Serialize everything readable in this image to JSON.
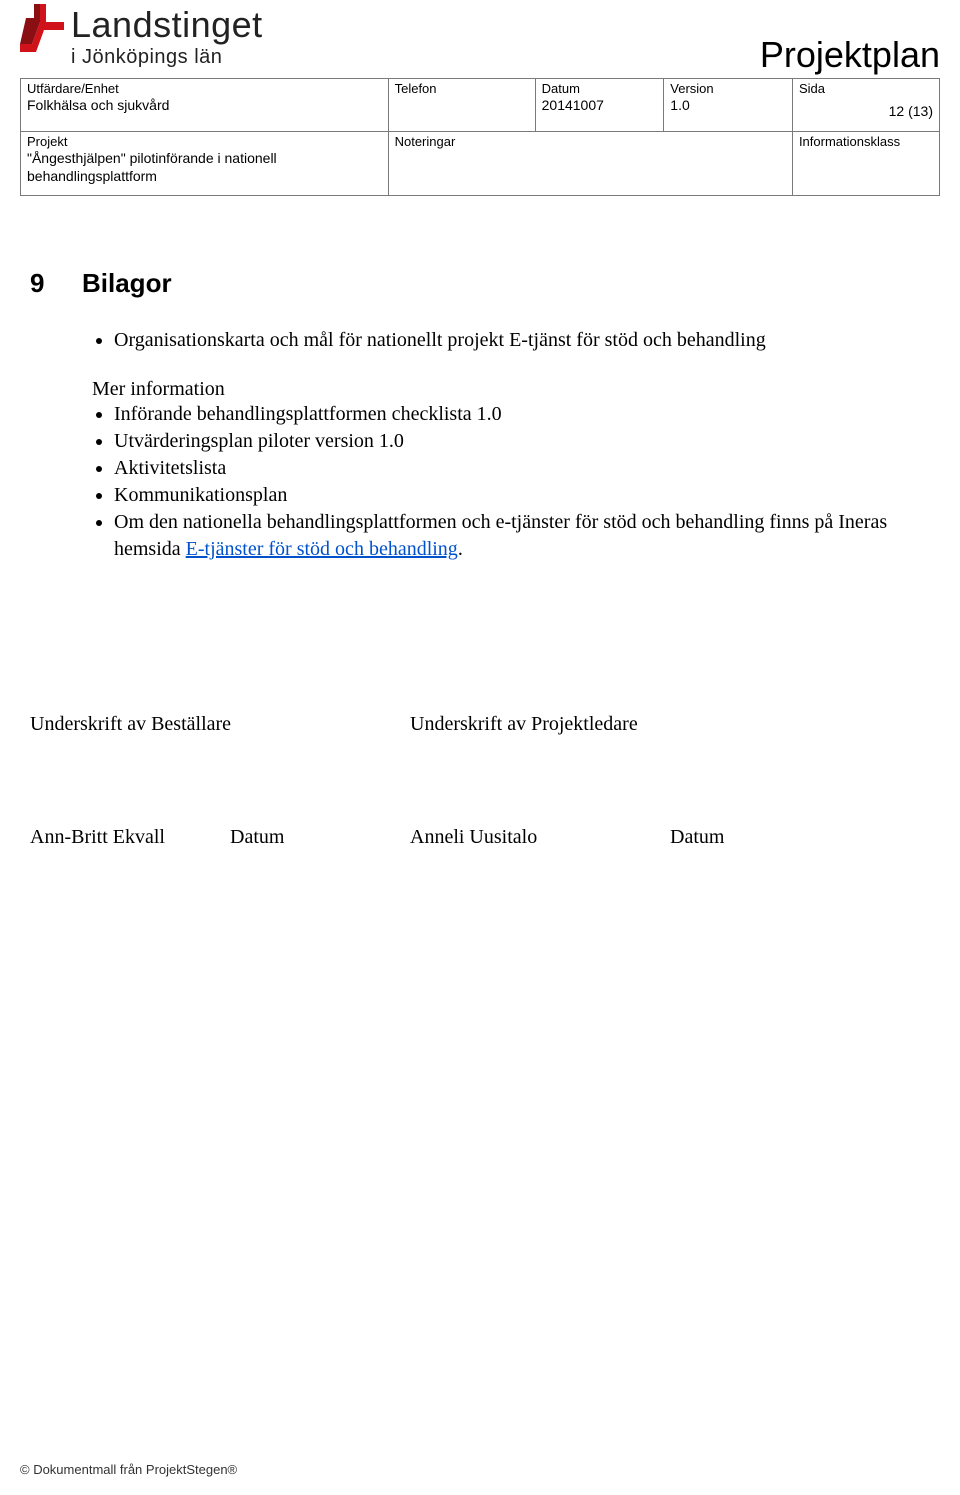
{
  "logo": {
    "line1": "Landstinget",
    "line2": "i Jönköpings län"
  },
  "doc_title": "Projektplan",
  "meta": {
    "issuer_label": "Utfärdare/Enhet",
    "issuer_value": "Folkhälsa och sjukvård",
    "tel_label": "Telefon",
    "tel_value": "",
    "date_label": "Datum",
    "date_value": "20141007",
    "version_label": "Version",
    "version_value": "1.0",
    "page_label": "Sida",
    "page_value": "12 (13)",
    "project_label": "Projekt",
    "project_value": "\"Ångesthjälpen\" pilotinförande i nationell behandlingsplattform",
    "notes_label": "Noteringar",
    "notes_value": "",
    "infoclass_label": "Informationsklass",
    "infoclass_value": ""
  },
  "section": {
    "number": "9",
    "title": "Bilagor"
  },
  "bullets_top": [
    "Organisationskarta och mål för nationellt projekt E-tjänst för stöd och behandling"
  ],
  "mid_para": "Mer information",
  "bullets_bottom": [
    "Införande behandlingsplattformen checklista 1.0",
    "Utvärderingsplan piloter version 1.0",
    "Aktivitetslista",
    "Kommunikationsplan"
  ],
  "bullet_link_line": {
    "prefix": "Om den nationella behandlingsplattformen och e-tjänster för stöd och behandling finns på Ineras hemsida ",
    "link_text": "E-tjänster för stöd och behandling",
    "suffix": "."
  },
  "signatures": {
    "left_header": "Underskrift av Beställare",
    "right_header": "Underskrift av Projektledare",
    "left_name": "Ann-Britt Ekvall",
    "date_label": "Datum",
    "right_name": "Anneli Uusitalo"
  },
  "footer": "© Dokumentmall från ProjektStegen®"
}
